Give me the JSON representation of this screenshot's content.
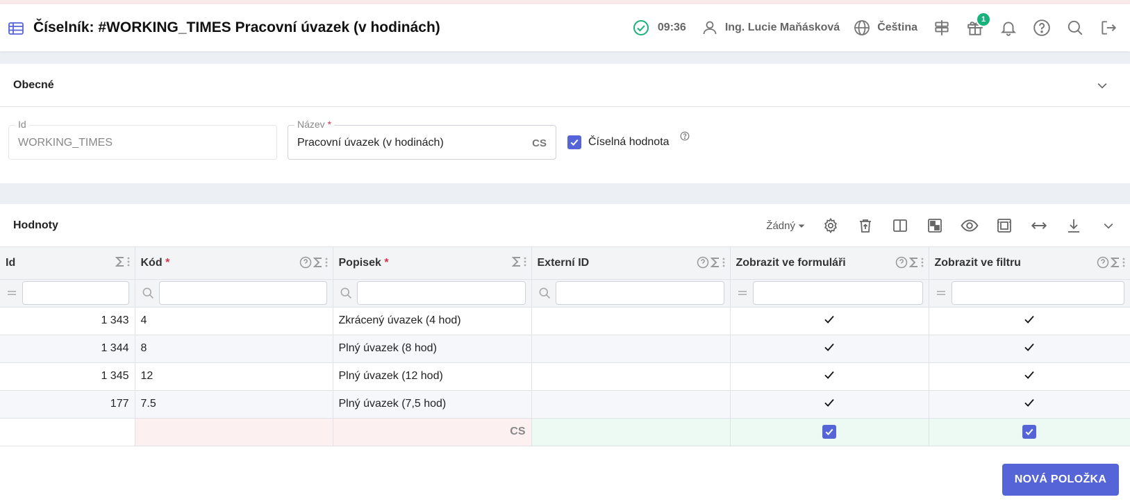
{
  "header": {
    "title": "Číselník: #WORKING_TIMES Pracovní úvazek (v hodinách)",
    "time": "09:36",
    "user": "Ing. Lucie Maňásková",
    "language": "Čeština",
    "gift_badge": "1"
  },
  "general": {
    "title": "Obecné",
    "id_label": "Id",
    "id_value": "WORKING_TIMES",
    "name_label": "Název",
    "name_required": "*",
    "name_value": "Pracovní úvazek (v hodinách)",
    "name_lang": "CS",
    "numeric_label": "Číselná hodnota"
  },
  "values": {
    "title": "Hodnoty",
    "view_select": "Žádný",
    "columns": [
      {
        "label": "Id",
        "required": ""
      },
      {
        "label": "Kód",
        "required": "*"
      },
      {
        "label": "Popisek",
        "required": "*"
      },
      {
        "label": "Externí ID",
        "required": ""
      },
      {
        "label": "Zobrazit ve formuláři",
        "required": ""
      },
      {
        "label": "Zobrazit ve filtru",
        "required": ""
      }
    ],
    "rows": [
      {
        "id": "1 343",
        "code": "4",
        "label": "Zkrácený úvazek (4 hod)",
        "ext": ""
      },
      {
        "id": "1 344",
        "code": "8",
        "label": "Plný úvazek (8 hod)",
        "ext": ""
      },
      {
        "id": "1 345",
        "code": "12",
        "label": "Plný úvazek (12 hod)",
        "ext": ""
      },
      {
        "id": "177",
        "code": "7.5",
        "label": "Plný úvazek (7,5 hod)",
        "ext": ""
      }
    ],
    "new_row_lang": "CS",
    "new_button": "NOVÁ POLOŽKA"
  },
  "colors": {
    "accent": "#5564d6",
    "success": "#19b27a",
    "required": "#d9324a"
  }
}
